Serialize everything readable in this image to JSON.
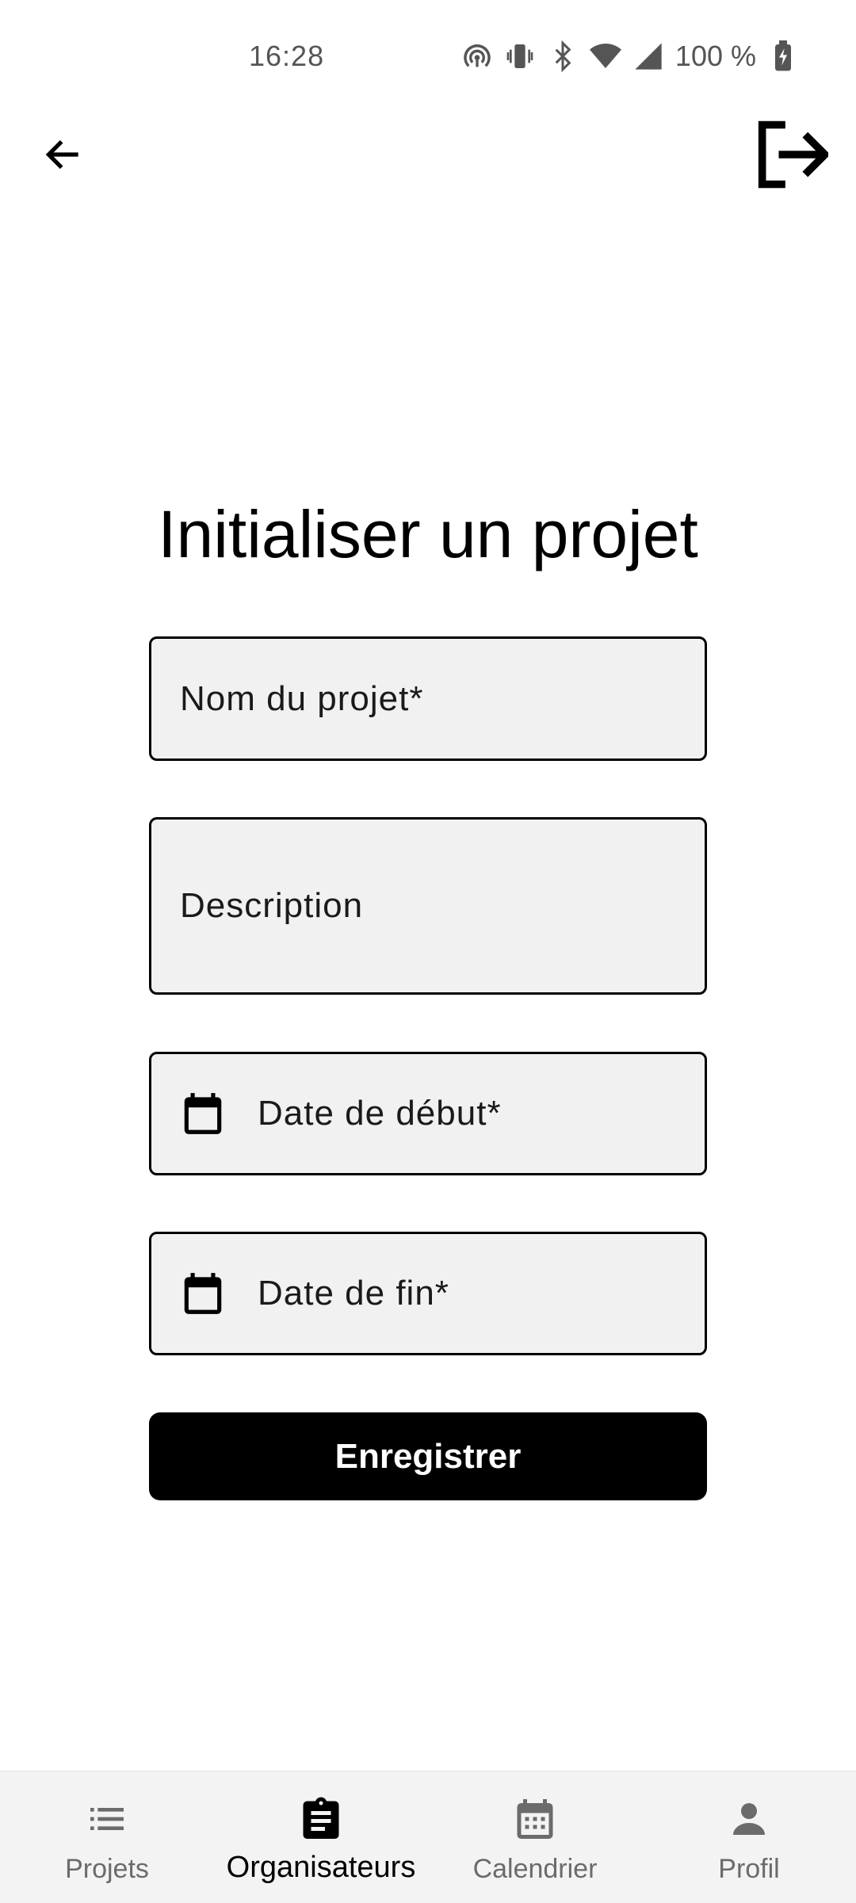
{
  "status_bar": {
    "time": "16:28",
    "battery": "100 %",
    "icons": [
      "hotspot-icon",
      "vibrate-icon",
      "bluetooth-icon",
      "wifi-icon",
      "signal-icon",
      "battery-charging-icon"
    ]
  },
  "top_bar": {
    "back_icon": "arrow-left-icon",
    "logout_icon": "logout-icon"
  },
  "form": {
    "title": "Initialiser un projet",
    "project_name_placeholder": "Nom du projet*",
    "description_placeholder": "Description",
    "start_date_placeholder": "Date de début*",
    "end_date_placeholder": "Date de fin*",
    "save_label": "Enregistrer"
  },
  "bottom_nav": {
    "active": "Organisateurs",
    "items": [
      {
        "label": "Projets",
        "icon": "list-icon"
      },
      {
        "label": "Organisateurs",
        "icon": "clipboard-icon"
      },
      {
        "label": "Calendrier",
        "icon": "calendar-icon"
      },
      {
        "label": "Profil",
        "icon": "person-icon"
      }
    ]
  },
  "colors": {
    "accent": "#000000",
    "field_bg": "#f1f1f1",
    "nav_bg": "#f3f3f3",
    "inactive": "#6b6b6b"
  }
}
